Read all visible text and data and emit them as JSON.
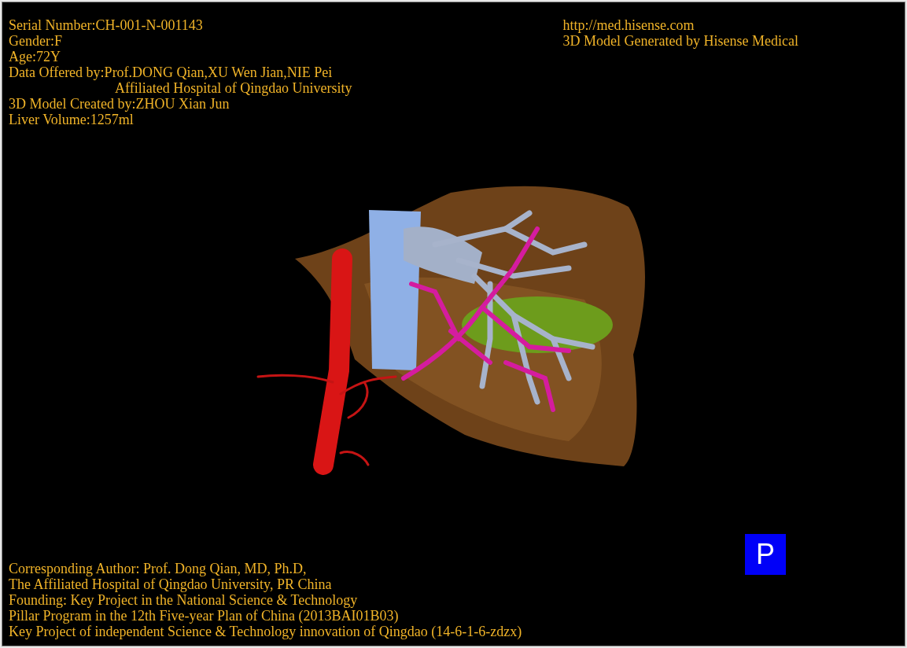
{
  "patient_info": [
    {
      "kind": "line",
      "text": "Serial Number:CH-001-N-001143"
    },
    {
      "kind": "line",
      "text": "Gender:F"
    },
    {
      "kind": "line",
      "text": "Age:72Y"
    },
    {
      "kind": "line",
      "text": "Data Offered by:Prof.DONG Qian,XU Wen Jian,NIE Pei"
    },
    {
      "kind": "continuation",
      "text": "Affiliated Hospital of Qingdao University"
    },
    {
      "kind": "line",
      "text": "3D Model Created by:ZHOU Xian Jun"
    },
    {
      "kind": "line",
      "text": "Liver Volume:1257ml"
    }
  ],
  "brand_info": [
    {
      "text": "http://med.hisense.com"
    },
    {
      "text": "3D Model Generated by Hisense Medical"
    }
  ],
  "view_button": {
    "label": "P"
  },
  "credits": [
    {
      "text": "Corresponding Author: Prof. Dong Qian, MD, Ph.D,"
    },
    {
      "text": "The Affiliated Hospital of Qingdao University, PR China"
    },
    {
      "text": "Founding: Key Project in the National Science & Technology"
    },
    {
      "text": "Pillar Program in the 12th Five-year Plan of China (2013BAI01B03)"
    },
    {
      "text": "Key Project of independent Science & Technology innovation of Qingdao (14-6-1-6-zdzx)"
    }
  ]
}
